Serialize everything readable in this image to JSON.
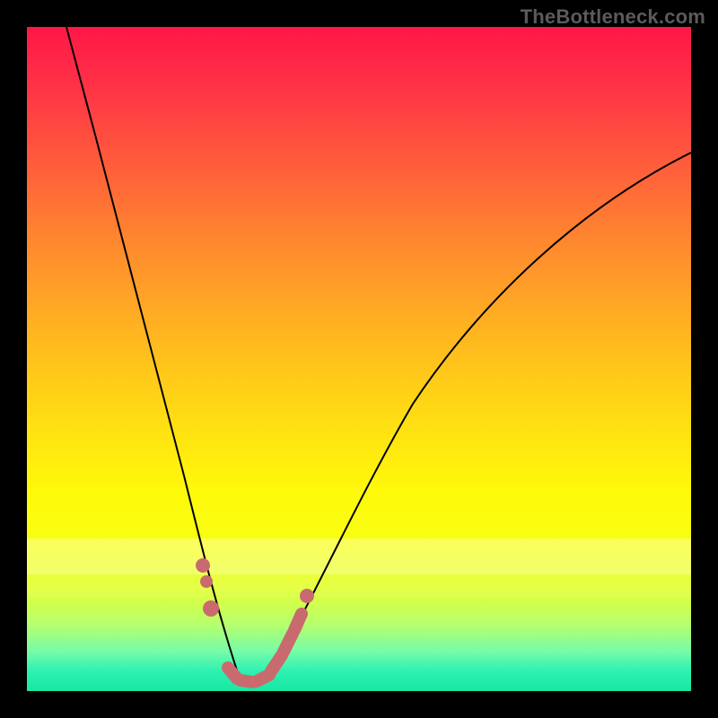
{
  "watermark": "TheBottleneck.com",
  "colors": {
    "curve": "#000000",
    "marker": "#c96b6e",
    "frame": "#000000"
  },
  "chart_data": {
    "type": "line",
    "title": "",
    "xlabel": "",
    "ylabel": "",
    "xlim": [
      0,
      100
    ],
    "ylim": [
      0,
      100
    ],
    "grid": false,
    "legend": false,
    "series": [
      {
        "name": "bottleneck-curve",
        "x": [
          6,
          8,
          10,
          12,
          14,
          16,
          18,
          20,
          22,
          24,
          26,
          27,
          28,
          29,
          30,
          31,
          32,
          33,
          34,
          36,
          38,
          40,
          44,
          48,
          52,
          56,
          60,
          64,
          68,
          72,
          76,
          80,
          84,
          88,
          92,
          96,
          100
        ],
        "y": [
          100,
          92,
          84,
          76,
          68,
          60,
          52,
          44,
          37,
          30,
          23,
          19,
          15,
          11,
          7,
          4,
          2,
          1,
          1,
          3,
          7,
          12,
          22,
          31,
          39,
          46,
          52,
          57,
          62,
          66,
          69,
          72,
          75,
          77,
          79,
          81,
          82
        ]
      }
    ],
    "markers": [
      {
        "name": "left-cluster-top",
        "x": 26.0,
        "y": 20,
        "r": 8
      },
      {
        "name": "left-cluster-mid",
        "x": 26.5,
        "y": 17,
        "r": 7
      },
      {
        "name": "left-cluster-bot",
        "x": 27.2,
        "y": 12,
        "r": 8
      },
      {
        "name": "valley-1",
        "x": 30.0,
        "y": 3,
        "r": 8
      },
      {
        "name": "valley-2",
        "x": 32.0,
        "y": 2,
        "r": 8
      },
      {
        "name": "valley-3",
        "x": 34.0,
        "y": 2,
        "r": 8
      },
      {
        "name": "right-rise-1",
        "x": 36.0,
        "y": 4,
        "r": 8
      },
      {
        "name": "right-rise-2",
        "x": 37.5,
        "y": 8,
        "r": 8
      },
      {
        "name": "right-rise-3",
        "x": 39.0,
        "y": 12,
        "r": 8
      },
      {
        "name": "right-top-dot",
        "x": 40.5,
        "y": 17,
        "r": 7
      }
    ]
  }
}
